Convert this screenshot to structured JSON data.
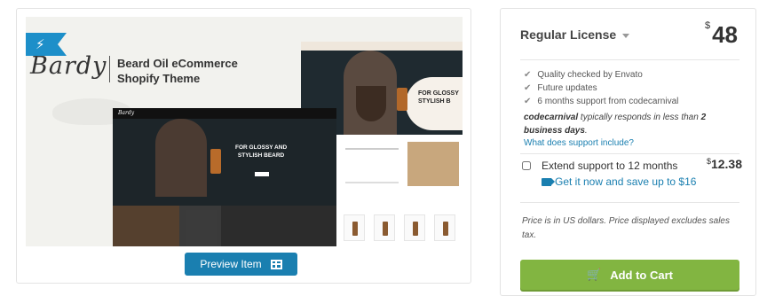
{
  "preview": {
    "brand": "Bardy",
    "tagline_line1": "Beard Oil eCommerce",
    "tagline_line2": "Shopify Theme",
    "hero_line1": "FOR GLOSSY AND",
    "hero_line2": "STYLISH BEARD",
    "back_hero_line1": "FOR GLOSSY",
    "back_hero_line2": "STYLISH B",
    "button_label": "Preview Item"
  },
  "license": {
    "title": "Regular License",
    "currency_symbol": "$",
    "price": "48",
    "features": [
      "Quality checked by Envato",
      "Future updates",
      "6 months support from codecarnival"
    ],
    "author": "codecarnival",
    "respond_text": " typically responds in less than ",
    "respond_bold": "2 business days",
    "respond_end": ".",
    "support_link": "What does support include?",
    "extend_label": "Extend support to 12 months",
    "extend_currency": "$",
    "extend_price": "12.38",
    "promo_text": "Get it now and save up to $16",
    "price_note": "Price is in US dollars. Price displayed excludes sales tax.",
    "cart_label": "Add to Cart"
  },
  "colors": {
    "accent_blue": "#1a7fb0",
    "cart_green": "#82b541"
  },
  "icons": [
    "bolt-icon",
    "check-icon",
    "tag-icon",
    "cart-icon",
    "grid-icon",
    "caret-down-icon"
  ]
}
